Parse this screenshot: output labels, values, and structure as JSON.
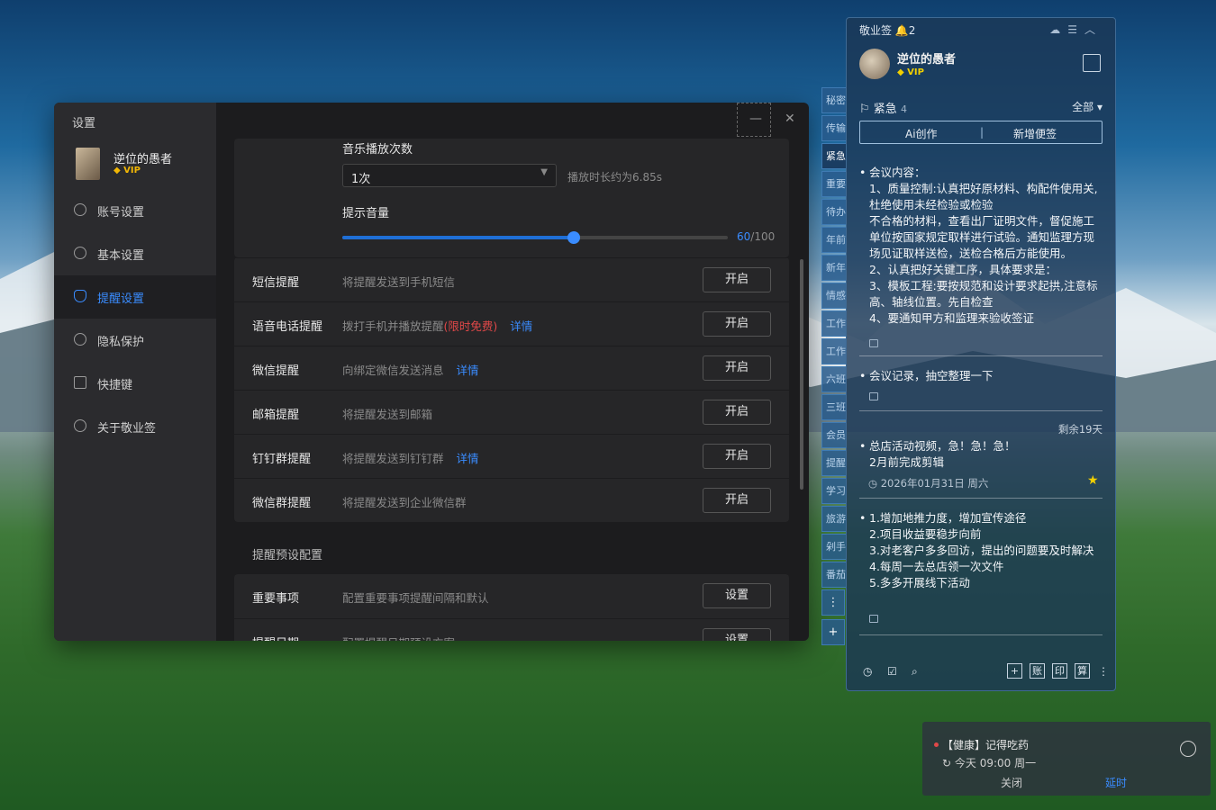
{
  "settings": {
    "title": "设置",
    "user_name": "逆位的愚者",
    "vip": "VIP",
    "nav": [
      "账号设置",
      "基本设置",
      "提醒设置",
      "隐私保护",
      "快捷键",
      "关于敬业签"
    ],
    "music_label": "音乐播放次数",
    "music_value": "1次",
    "music_hint": "播放时长约为6.85s",
    "volume_label": "提示音量",
    "volume": 60,
    "volume_text": "60",
    "volume_max": "/100",
    "reminders": [
      {
        "title": "短信提醒",
        "desc": "将提醒发送到手机短信",
        "btn": "开启"
      },
      {
        "title": "语音电话提醒",
        "desc": "拨打手机并播放提醒",
        "extra": "(限时免费)",
        "link": "详情",
        "btn": "开启"
      },
      {
        "title": "微信提醒",
        "desc": "向绑定微信发送消息",
        "link": "详情",
        "btn": "开启"
      },
      {
        "title": "邮箱提醒",
        "desc": "将提醒发送到邮箱",
        "btn": "开启"
      },
      {
        "title": "钉钉群提醒",
        "desc": "将提醒发送到钉钉群",
        "link": "详情",
        "btn": "开启"
      },
      {
        "title": "微信群提醒",
        "desc": "将提醒发送到企业微信群",
        "btn": "开启"
      }
    ],
    "preset_title": "提醒预设配置",
    "presets": [
      {
        "title": "重要事项",
        "desc": "配置重要事项提醒间隔和默认",
        "btn": "设置"
      },
      {
        "title": "提醒日期",
        "desc": "配置提醒日期预设方案",
        "btn": "设置"
      }
    ]
  },
  "tabs": [
    "秘密",
    "传输",
    "紧急",
    "重要",
    "待办",
    "年前",
    "新年",
    "情感",
    "工作",
    "工作",
    "六班",
    "三班",
    "会员",
    "提醒",
    "学习",
    "旅游",
    "剁手",
    "番茄"
  ],
  "panel": {
    "app": "敬业签",
    "bell_count": "2",
    "user_name": "逆位的愚者",
    "vip": "VIP",
    "category": "紧急",
    "category_count": "4",
    "filter": "全部",
    "ai_btn": "Ai创作",
    "new_btn": "新增便签",
    "notes": [
      {
        "text": "会议内容：\n1、质量控制:认真把好原材料、构配件使用关,杜绝使用未经检验或检验\n不合格的材料，查看出厂证明文件，督促施工单位按国家规定取样进行试验。通知监理方现场见证取样送检，送检合格后方能使用。\n2、认真把好关键工序，具体要求是：\n3、模板工程:要按规范和设计要求起拱,注意标高、轴线位置。先自检查\n4、要通知甲方和监理来验收签证"
      },
      {
        "text": "会议记录，抽空整理一下"
      },
      {
        "remain": "剩余19天",
        "text": "总店活动视频，急！急！急！\n2月前完成剪辑",
        "date": "2026年01月31日 周六"
      },
      {
        "text": "1.增加地推力度，增加宣传途径\n2.项目收益要稳步向前\n3.对老客户多多回访，提出的问题要及时解决\n4.每周一去总店领一次文件\n5.多多开展线下活动"
      }
    ],
    "bottom_icons": [
      "账",
      "印",
      "算"
    ]
  },
  "toast": {
    "title": "【健康】记得吃药",
    "time": "今天 09:00 周一",
    "close": "关闭",
    "delay": "延时"
  }
}
